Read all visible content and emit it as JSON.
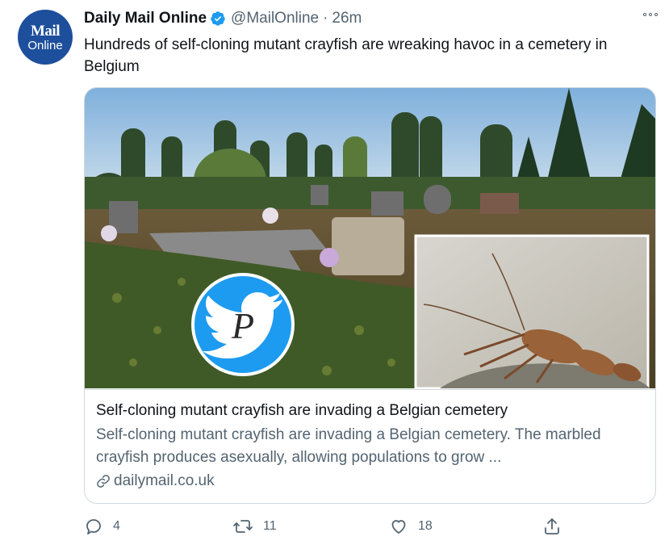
{
  "tweet": {
    "avatar": {
      "line1": "Mail",
      "line2": "Online"
    },
    "author_name": "Daily Mail Online",
    "handle": "@MailOnline",
    "separator": "·",
    "time": "26m",
    "text": "Hundreds of self-cloning mutant crayfish are wreaking havoc in a cemetery in Belgium"
  },
  "card": {
    "title": "Self-cloning mutant crayfish are invading a Belgian cemetery",
    "description": "Self-cloning mutant crayfish are invading a Belgian cemetery. The marbled crayfish produces asexually, allowing populations to grow ...",
    "domain": "dailymail.co.uk",
    "watermark_letter": "P"
  },
  "actions": {
    "replies": "4",
    "retweets": "11",
    "likes": "18"
  },
  "icons": {
    "verified": "verified-badge-icon",
    "more": "more-options-icon",
    "link": "link-icon",
    "reply": "reply-icon",
    "retweet": "retweet-icon",
    "like": "like-icon",
    "share": "share-icon",
    "watermark": "bird-logo-icon"
  },
  "colors": {
    "brand_blue": "#1d9bf0",
    "verified": "#1d9bf0",
    "avatar_bg": "#1d4f9c",
    "text_primary": "#0f1419",
    "text_secondary": "#536471",
    "border": "#cfd9de"
  }
}
